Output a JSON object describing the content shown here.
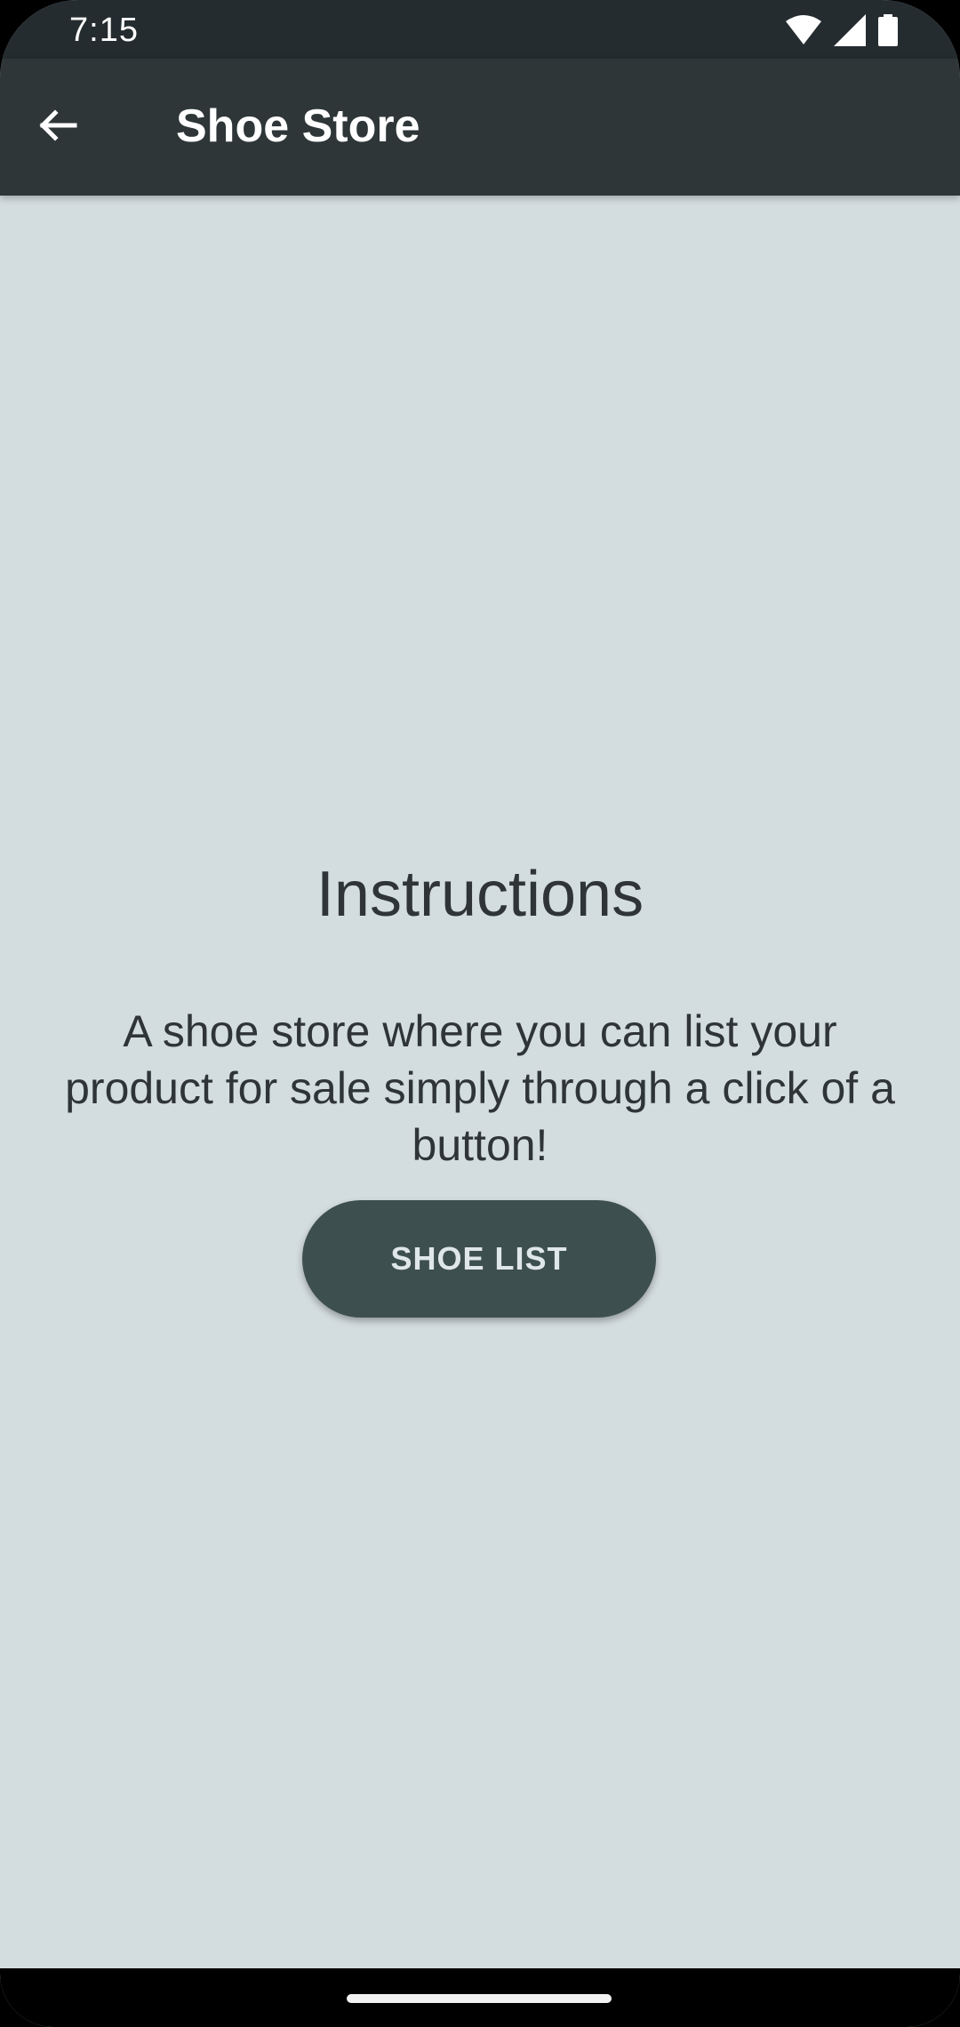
{
  "status_bar": {
    "time": "7:15",
    "icons": [
      "wifi-icon",
      "cellular-signal-icon",
      "battery-icon"
    ]
  },
  "app_bar": {
    "back_icon": "arrow-back-icon",
    "title": "Shoe Store"
  },
  "main": {
    "heading": "Instructions",
    "description": "A shoe store where you can list your product for sale simply through a click of a button!",
    "button_label": "SHOE LIST"
  },
  "colors": {
    "background": "#d3dcde",
    "app_bar": "#2e3638",
    "status_bar": "#242c30",
    "button": "#3e4f50",
    "text": "#2f3537"
  }
}
